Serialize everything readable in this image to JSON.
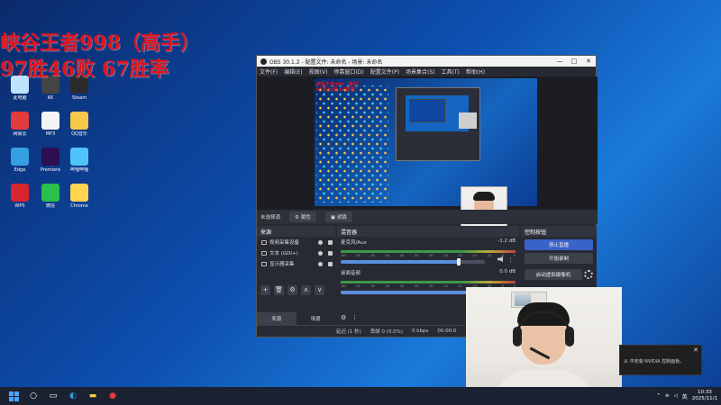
{
  "overlay": {
    "line1": "峡谷王者998（高手）",
    "line2": "97胜46败 67胜率"
  },
  "desktop": {
    "icons": [
      {
        "label": "此电脑",
        "color": "#bfe3ff"
      },
      {
        "label": "KK",
        "color": "#444"
      },
      {
        "label": "Steam",
        "color": "#2b2b2b"
      },
      {
        "label": "网易云",
        "color": "#e23b3b"
      },
      {
        "label": "MP3",
        "color": "#f5f5f5"
      },
      {
        "label": "QQ音乐",
        "color": "#f7c948"
      },
      {
        "label": "Edge",
        "color": "#34a0e3"
      },
      {
        "label": "Premiere",
        "color": "#2d0e4f"
      },
      {
        "label": "哔哩哔哩",
        "color": "#4fc3f7"
      },
      {
        "label": "WPS",
        "color": "#d7262e"
      },
      {
        "label": "微信",
        "color": "#2bc04a"
      },
      {
        "label": "Chrome",
        "color": "#ffd54f"
      }
    ]
  },
  "obs": {
    "title": "OBS 30.1.2 - 配置文件: 未命名 - 场景: 未命名",
    "window_controls": {
      "minimize": "—",
      "maximize": "□",
      "close": "✕"
    },
    "menu": [
      "文件(F)",
      "编辑(E)",
      "视图(V)",
      "停靠窗口(D)",
      "配置文件(P)",
      "场景集合(S)",
      "工具(T)",
      "帮助(H)"
    ],
    "preview_overlay": {
      "line1": "峡谷王者998（高手）",
      "line2": "97胜46败 67胜率"
    },
    "source_bar": {
      "label": "未选择源",
      "properties_button": "属性",
      "filters_button": "滤镜"
    },
    "sources_panel": {
      "title": "来源",
      "items": [
        {
          "label": "视频采集设备"
        },
        {
          "label": "文本 (GDI+)"
        },
        {
          "label": "显示器采集"
        }
      ],
      "tools": [
        "+",
        "🗑",
        "⚙",
        "∧",
        "∨"
      ],
      "tabs": [
        "来源",
        "场景"
      ]
    },
    "mixer_panel": {
      "title": "混音器",
      "tracks": [
        {
          "name": "麦克风/Aux",
          "level": "-1.2 dB",
          "fader": 0.82
        },
        {
          "name": "桌面音频",
          "level": "0.0 dB",
          "fader": 1.0
        }
      ],
      "scale": [
        "-60",
        "-55",
        "-50",
        "-45",
        "-40",
        "-35",
        "-30",
        "-25",
        "-20",
        "-15",
        "-10",
        "-5",
        "0"
      ]
    },
    "controls_panel": {
      "title": "控制按钮",
      "stop_stream": "停止直播",
      "start_record": "开始录制",
      "virtual_cam": "启动虚拟摄像机"
    },
    "status": {
      "latency": "延迟 (1 秒)",
      "dropped": "丢帧 0 (0.0%)",
      "bitrate": "0 kbps",
      "time": "00:00:0"
    }
  },
  "notification": {
    "text": "从 中安装 NVIDIA 控制面板。",
    "close": "✕"
  },
  "taskbar": {
    "tray": {
      "lang": "英",
      "time": "10:33",
      "date": "2025/11/1"
    }
  }
}
